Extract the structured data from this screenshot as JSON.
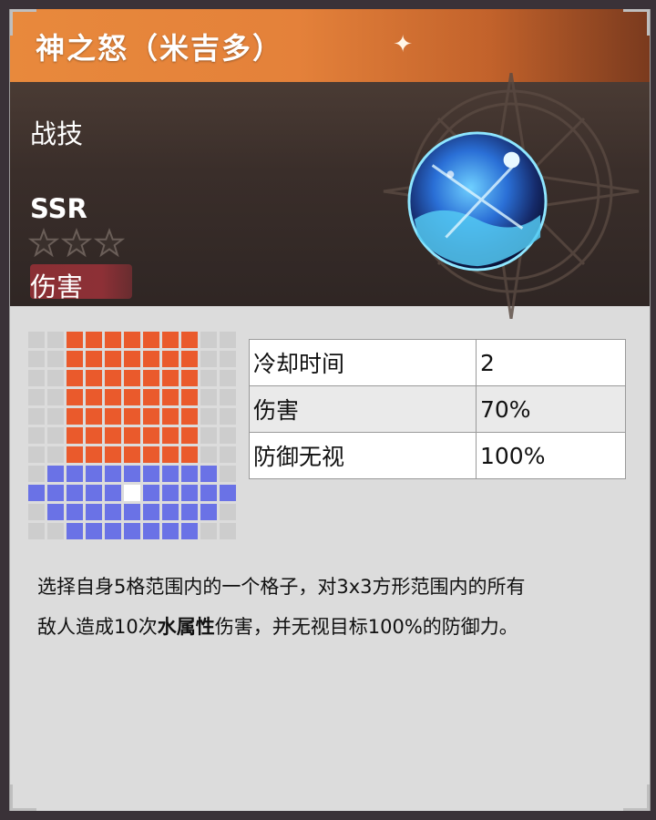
{
  "title": "神之怒（米吉多）",
  "skill_type": "战技",
  "rarity": "SSR",
  "stars": 3,
  "category": "伤害",
  "range_grid": [
    [
      0,
      0,
      1,
      1,
      1,
      1,
      1,
      1,
      1,
      0,
      0
    ],
    [
      0,
      0,
      1,
      1,
      1,
      1,
      1,
      1,
      1,
      0,
      0
    ],
    [
      0,
      0,
      1,
      1,
      1,
      1,
      1,
      1,
      1,
      0,
      0
    ],
    [
      0,
      0,
      1,
      1,
      1,
      1,
      1,
      1,
      1,
      0,
      0
    ],
    [
      0,
      0,
      1,
      1,
      1,
      1,
      1,
      1,
      1,
      0,
      0
    ],
    [
      0,
      0,
      1,
      1,
      1,
      1,
      1,
      1,
      1,
      0,
      0
    ],
    [
      0,
      0,
      1,
      1,
      1,
      1,
      1,
      1,
      1,
      0,
      0
    ],
    [
      0,
      2,
      2,
      2,
      2,
      2,
      2,
      2,
      2,
      2,
      0
    ],
    [
      2,
      2,
      2,
      2,
      2,
      3,
      2,
      2,
      2,
      2,
      2
    ],
    [
      0,
      2,
      2,
      2,
      2,
      2,
      2,
      2,
      2,
      2,
      0
    ],
    [
      0,
      0,
      2,
      2,
      2,
      2,
      2,
      2,
      2,
      0,
      0
    ]
  ],
  "stats": [
    {
      "label": "冷却时间",
      "value": "2"
    },
    {
      "label": "伤害",
      "value": "70%"
    },
    {
      "label": "防御无视",
      "value": "100%"
    }
  ],
  "description": {
    "line1": "选择自身5格范围内的一个格子，对3x3方形范围内的所有",
    "line2_before": "敌人造成10次",
    "line2_bold": "水属性",
    "line2_after": "伤害，并无视目标100%的防御力。"
  },
  "colors": {
    "title_bar": "#e4813a",
    "attack_cell": "#ea5a2c",
    "move_cell": "#6a72e6",
    "self_cell": "#ffffff",
    "category_badge": "#8a2f34"
  },
  "icons": {
    "orb": "water-orb-icon",
    "star": "star-outline-icon"
  }
}
